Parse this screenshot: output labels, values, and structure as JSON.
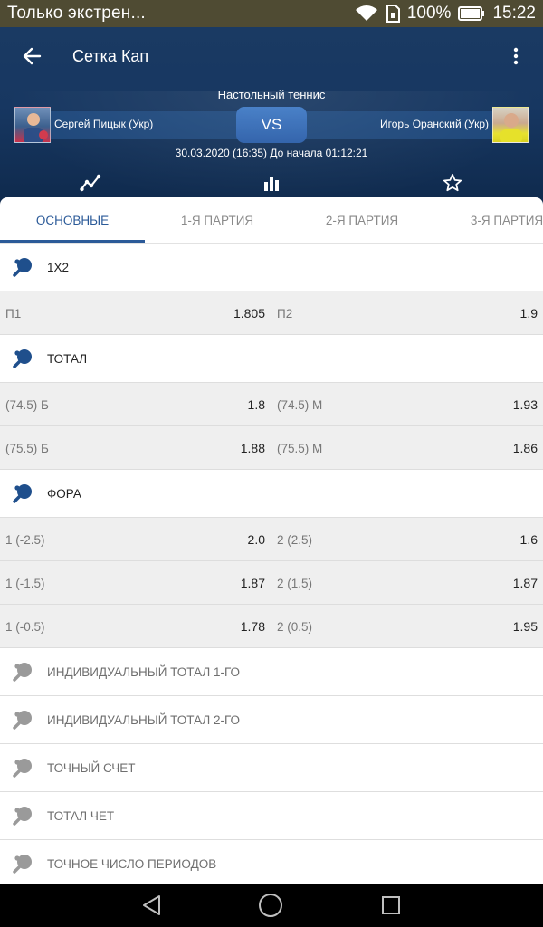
{
  "status_bar": {
    "notification": "Только экстрен...",
    "battery_percent": "100%",
    "time": "15:22"
  },
  "header": {
    "title": "Сетка Кап",
    "sport": "Настольный теннис",
    "player1": "Сергей Пицык (Укр)",
    "player2": "Игорь Оранский (Укр)",
    "vs_label": "VS",
    "datetime": "30.03.2020 (16:35) До начала 01:12:21",
    "icons": [
      "line-chart-icon",
      "bar-chart-icon",
      "star-icon"
    ]
  },
  "tabs": [
    {
      "label": "ОСНОВНЫЕ",
      "active": true
    },
    {
      "label": "1-Я ПАРТИЯ",
      "active": false
    },
    {
      "label": "2-Я ПАРТИЯ",
      "active": false
    },
    {
      "label": "3-Я ПАРТИЯ",
      "active": false
    }
  ],
  "markets": {
    "m1x2": {
      "title": "1X2",
      "rows": [
        {
          "l_label": "П1",
          "l_value": "1.805",
          "r_label": "П2",
          "r_value": "1.9"
        }
      ]
    },
    "total": {
      "title": "ТОТАЛ",
      "rows": [
        {
          "l_label": "(74.5) Б",
          "l_value": "1.8",
          "r_label": "(74.5) М",
          "r_value": "1.93"
        },
        {
          "l_label": "(75.5) Б",
          "l_value": "1.88",
          "r_label": "(75.5) М",
          "r_value": "1.86"
        }
      ]
    },
    "fora": {
      "title": "ФОРА",
      "rows": [
        {
          "l_label": "1 (-2.5)",
          "l_value": "2.0",
          "r_label": "2 (2.5)",
          "r_value": "1.6"
        },
        {
          "l_label": "1 (-1.5)",
          "l_value": "1.87",
          "r_label": "2 (1.5)",
          "r_value": "1.87"
        },
        {
          "l_label": "1 (-0.5)",
          "l_value": "1.78",
          "r_label": "2 (0.5)",
          "r_value": "1.95"
        }
      ]
    }
  },
  "collapsed_markets": [
    "ИНДИВИДУАЛЬНЫЙ ТОТАЛ 1-ГО",
    "ИНДИВИДУАЛЬНЫЙ ТОТАЛ 2-ГО",
    "ТОЧНЫЙ СЧЕТ",
    "ТОТАЛ ЧЕТ",
    "ТОЧНОЕ ЧИСЛО ПЕРИОДОВ"
  ],
  "colors": {
    "header_bg": "#173761",
    "accent": "#2b5a98",
    "icon_active": "#1f4f8c",
    "icon_inactive": "#9a9a9a"
  }
}
